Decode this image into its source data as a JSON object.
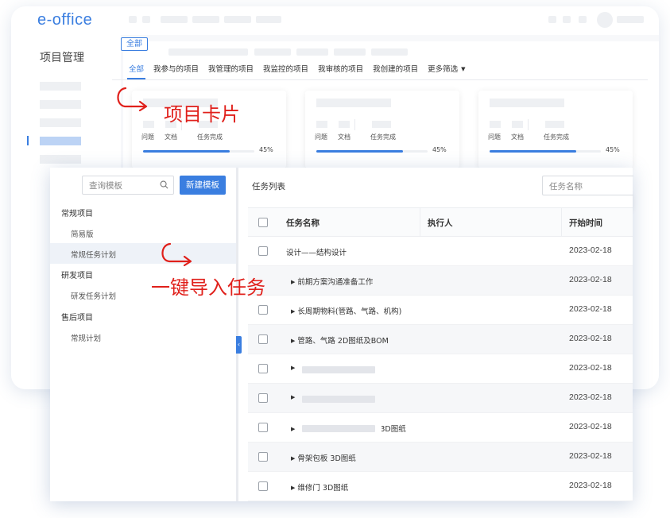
{
  "app": {
    "logo": "e-office"
  },
  "sidebar": {
    "title": "项目管理"
  },
  "filter": {
    "all_chip": "全部",
    "tabs": [
      {
        "label": "全部",
        "active": true
      },
      {
        "label": "我参与的项目"
      },
      {
        "label": "我管理的项目"
      },
      {
        "label": "我监控的项目"
      },
      {
        "label": "我审核的项目"
      },
      {
        "label": "我创建的项目"
      },
      {
        "label": "更多筛选"
      }
    ]
  },
  "cards": [
    {
      "labels": [
        "问题",
        "文档",
        "任务完成"
      ],
      "progress_percent": 45,
      "progress_text": "45%"
    },
    {
      "labels": [
        "问题",
        "文档",
        "任务完成"
      ],
      "progress_percent": 45,
      "progress_text": "45%"
    },
    {
      "labels": [
        "问题",
        "文档",
        "任务完成"
      ],
      "progress_percent": 45,
      "progress_text": "45%"
    }
  ],
  "templates": {
    "search_placeholder": "查询模板",
    "new_button": "新建模板",
    "groups": [
      {
        "label": "常规项目",
        "items": [
          "简易版",
          "常规任务计划"
        ]
      },
      {
        "label": "研发项目",
        "items": [
          "研发任务计划"
        ]
      },
      {
        "label": "售后项目",
        "items": [
          "常规计划"
        ]
      }
    ],
    "selected": "常规任务计划"
  },
  "task_list": {
    "title": "任务列表",
    "search_placeholder": "任务名称",
    "columns": [
      "任务名称",
      "执行人",
      "开始时间"
    ],
    "rows": [
      {
        "name": "设计——结构设计",
        "start": "2023-02-18"
      },
      {
        "name": "前期方案沟通准备工作",
        "start": "2023-02-18"
      },
      {
        "name": "长周期物料(管路、气路、机构)",
        "start": "2023-02-18"
      },
      {
        "name": "管路、气路 2D图纸及BOM",
        "start": "2023-02-18"
      },
      {
        "name": "",
        "start": "2023-02-18"
      },
      {
        "name": "",
        "start": "2023-02-18"
      },
      {
        "name": "3D图纸",
        "start": "2023-02-18"
      },
      {
        "name": "骨架包板 3D图纸",
        "start": "2023-02-18"
      },
      {
        "name": "维修门 3D图纸",
        "start": "2023-02-18"
      }
    ]
  },
  "annotations": {
    "cards": "项目卡片",
    "import": "一键导入任务"
  },
  "colors": {
    "accent": "#3a7ee0",
    "annotation": "#e0201b"
  }
}
